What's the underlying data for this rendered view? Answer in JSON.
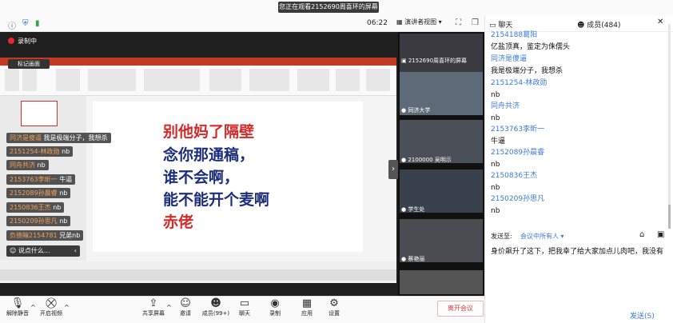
{
  "window": {
    "banner": "您正在观看2152690周喜环的屏幕",
    "timer": "06:22",
    "view_button": "演讲者视图",
    "recording": "录制中",
    "mark_button": "标记画面"
  },
  "slide": {
    "lines": [
      "别他妈了隔壁",
      "念你那通稿，",
      "谁不会啊，",
      "能不能开个麦啊",
      "赤佬"
    ],
    "line_colors": [
      "#d42a2a",
      "#1c2f7c",
      "#1c2f7c",
      "#1c2f7c",
      "#d42a2a"
    ]
  },
  "overlay_chat": [
    {
      "name": "同济是傻逼",
      "text": "我是极端分子，我想杀"
    },
    {
      "name": "2151254-林政勋",
      "text": "nb"
    },
    {
      "name": "同舟共济",
      "text": "nb"
    },
    {
      "name": "2153763李昕一",
      "text": "牛逼"
    },
    {
      "name": "2152089孙晨睿",
      "text": "nb"
    },
    {
      "name": "2150836王杰",
      "text": "nb"
    },
    {
      "name": "2150209孙思凡",
      "text": "nb"
    },
    {
      "name": "负债嘛2154781",
      "text": "兄弟nb"
    }
  ],
  "overlay_input": "说点什么...",
  "participants": [
    {
      "name": "2152690周喜环的屏幕"
    },
    {
      "name": "同济大学"
    },
    {
      "name": "2100000 吴明示"
    },
    {
      "name": "学生处"
    },
    {
      "name": "蔡艳丽"
    }
  ],
  "chat": {
    "title": "聊天",
    "members": "成员(484)",
    "messages": [
      {
        "sender": "2154188葛阳",
        "content": "亿盐顶真，鉴定为侏儒头"
      },
      {
        "sender": "同济是傻逼",
        "content": "我是极端分子，我想杀"
      },
      {
        "sender": "2151254-林政勋",
        "content": "nb"
      },
      {
        "sender": "同舟共济",
        "content": "nb"
      },
      {
        "sender": "2153763李昕一",
        "content": "牛逼"
      },
      {
        "sender": "2152089孙晨睿",
        "content": "nb"
      },
      {
        "sender": "2150836王杰",
        "content": "nb"
      },
      {
        "sender": "2150209孙思凡",
        "content": "nb"
      }
    ],
    "send_to_label": "发送至:",
    "send_to_target": "会议中所有人",
    "draft": "身价飙升了这下，把我幸了给大家加点儿肉吧，我没有",
    "send_button": "发送(S)"
  },
  "toolbar": {
    "mute": "解除静音",
    "video": "开启视频",
    "share": "共享屏幕",
    "invite": "邀请",
    "members": "成员(99+)",
    "chat": "聊天",
    "record": "录制",
    "apps": "应用",
    "settings": "设置",
    "leave": "离开会议"
  }
}
